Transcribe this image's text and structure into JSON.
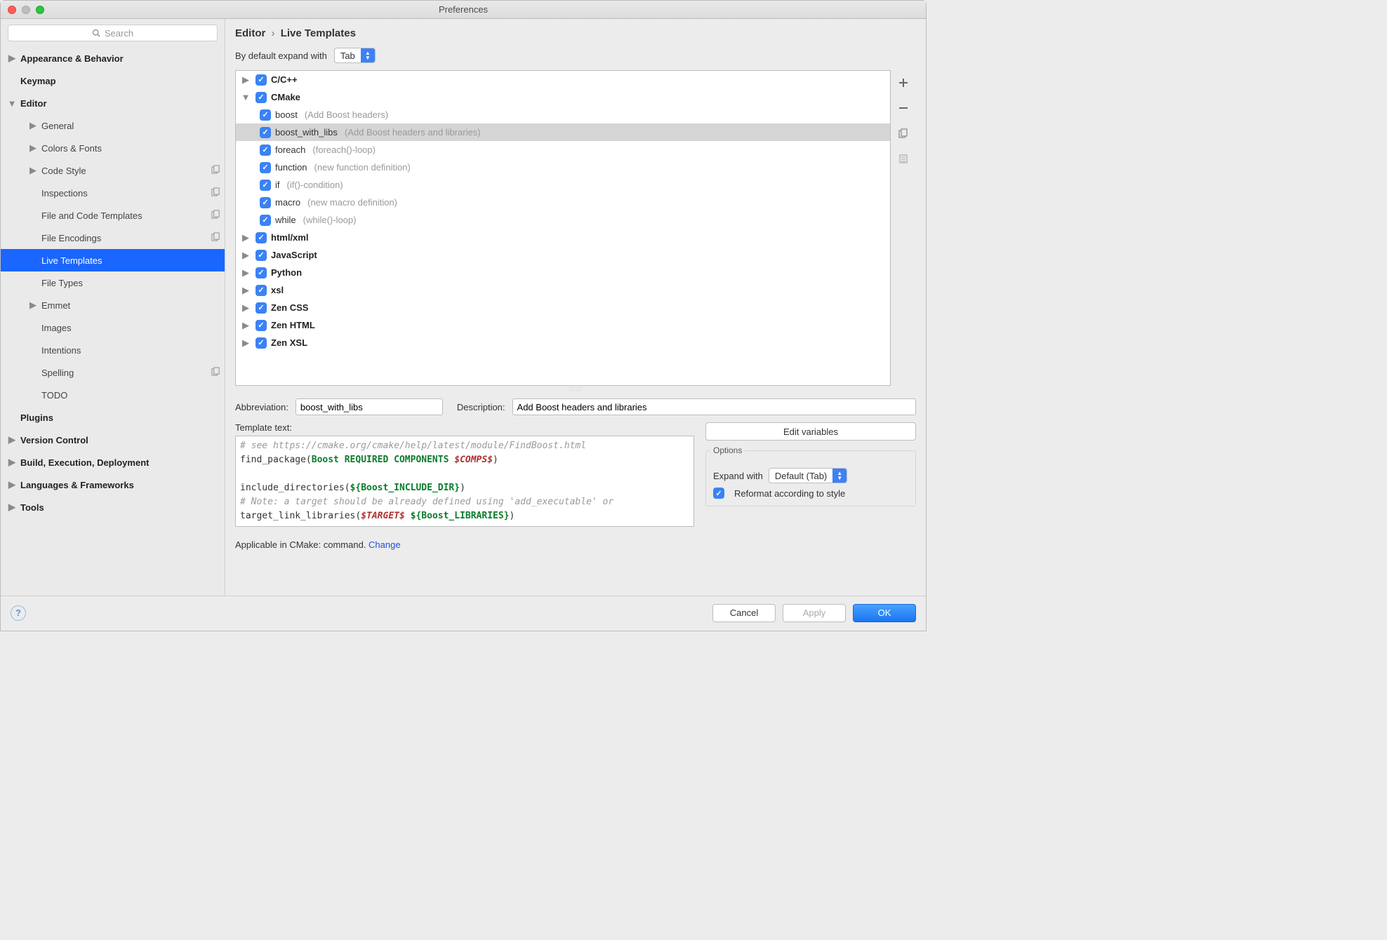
{
  "title": "Preferences",
  "search": {
    "placeholder": "Search"
  },
  "sidebar": [
    {
      "label": "Appearance & Behavior",
      "depth": 0,
      "bold": true,
      "arrow": "right"
    },
    {
      "label": "Keymap",
      "depth": 0,
      "bold": true
    },
    {
      "label": "Editor",
      "depth": 0,
      "bold": true,
      "arrow": "down"
    },
    {
      "label": "General",
      "depth": 1,
      "arrow": "right"
    },
    {
      "label": "Colors & Fonts",
      "depth": 1,
      "arrow": "right"
    },
    {
      "label": "Code Style",
      "depth": 1,
      "arrow": "right",
      "copy": true
    },
    {
      "label": "Inspections",
      "depth": 1,
      "copy": true
    },
    {
      "label": "File and Code Templates",
      "depth": 1,
      "copy": true
    },
    {
      "label": "File Encodings",
      "depth": 1,
      "copy": true
    },
    {
      "label": "Live Templates",
      "depth": 1,
      "selected": true
    },
    {
      "label": "File Types",
      "depth": 1
    },
    {
      "label": "Emmet",
      "depth": 1,
      "arrow": "right"
    },
    {
      "label": "Images",
      "depth": 1
    },
    {
      "label": "Intentions",
      "depth": 1
    },
    {
      "label": "Spelling",
      "depth": 1,
      "copy": true
    },
    {
      "label": "TODO",
      "depth": 1
    },
    {
      "label": "Plugins",
      "depth": 0,
      "bold": true
    },
    {
      "label": "Version Control",
      "depth": 0,
      "bold": true,
      "arrow": "right"
    },
    {
      "label": "Build, Execution, Deployment",
      "depth": 0,
      "bold": true,
      "arrow": "right"
    },
    {
      "label": "Languages & Frameworks",
      "depth": 0,
      "bold": true,
      "arrow": "right"
    },
    {
      "label": "Tools",
      "depth": 0,
      "bold": true,
      "arrow": "right"
    }
  ],
  "breadcrumb": {
    "a": "Editor",
    "b": "Live Templates"
  },
  "expand": {
    "label": "By default expand with",
    "value": "Tab"
  },
  "templates": [
    {
      "depth": 0,
      "arrow": "right",
      "name": "C/C++",
      "bold": true
    },
    {
      "depth": 0,
      "arrow": "down",
      "name": "CMake",
      "bold": true
    },
    {
      "depth": 1,
      "name": "boost",
      "hint": "(Add Boost headers)"
    },
    {
      "depth": 1,
      "name": "boost_with_libs",
      "hint": "(Add Boost headers and libraries)",
      "selected": true
    },
    {
      "depth": 1,
      "name": "foreach",
      "hint": "(foreach()-loop)"
    },
    {
      "depth": 1,
      "name": "function",
      "hint": "(new function definition)"
    },
    {
      "depth": 1,
      "name": "if",
      "hint": "(if()-condition)"
    },
    {
      "depth": 1,
      "name": "macro",
      "hint": "(new macro definition)"
    },
    {
      "depth": 1,
      "name": "while",
      "hint": "(while()-loop)"
    },
    {
      "depth": 0,
      "arrow": "right",
      "name": "html/xml",
      "bold": true
    },
    {
      "depth": 0,
      "arrow": "right",
      "name": "JavaScript",
      "bold": true
    },
    {
      "depth": 0,
      "arrow": "right",
      "name": "Python",
      "bold": true
    },
    {
      "depth": 0,
      "arrow": "right",
      "name": "xsl",
      "bold": true
    },
    {
      "depth": 0,
      "arrow": "right",
      "name": "Zen CSS",
      "bold": true
    },
    {
      "depth": 0,
      "arrow": "right",
      "name": "Zen HTML",
      "bold": true
    },
    {
      "depth": 0,
      "arrow": "right",
      "name": "Zen XSL",
      "bold": true
    }
  ],
  "form": {
    "abbr_label": "Abbreviation:",
    "abbr_value": "boost_with_libs",
    "desc_label": "Description:",
    "desc_value": "Add Boost headers and libraries",
    "text_label": "Template text:",
    "edit_vars": "Edit variables",
    "options_label": "Options",
    "expand_with_label": "Expand with",
    "expand_with_value": "Default (Tab)",
    "reformat_label": "Reformat according to style",
    "applicable_prefix": "Applicable in CMake: command. ",
    "applicable_change": "Change"
  },
  "code": {
    "l1": "# see https://cmake.org/cmake/help/latest/module/FindBoost.html",
    "l2a": "find_package(",
    "l2b": "Boost REQUIRED COMPONENTS ",
    "l2c": "$COMPS$",
    "l2d": ")",
    "l3": "",
    "l4a": "include_directories(",
    "l4b": "${Boost_INCLUDE_DIR}",
    "l4c": ")",
    "l5": "# Note: a target should be already defined using 'add_executable' or",
    "l6a": "target_link_libraries(",
    "l6b": "$TARGET$",
    "l6c": " ",
    "l6d": "${Boost_LIBRARIES}",
    "l6e": ")"
  },
  "footer": {
    "cancel": "Cancel",
    "apply": "Apply",
    "ok": "OK"
  }
}
